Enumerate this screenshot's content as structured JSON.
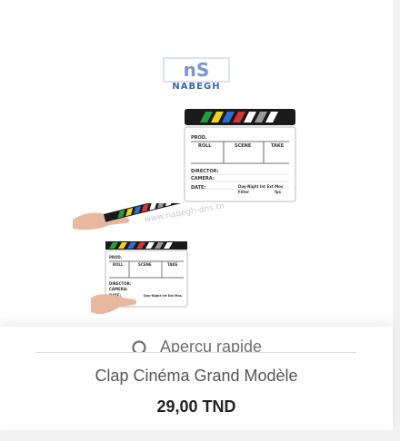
{
  "brand": {
    "logo_text": "NABEGH",
    "logo_mark": "nS",
    "watermark": "www.nabegh-dns.tn"
  },
  "clapper": {
    "prod_label": "PROD.",
    "roll_label": "ROLL",
    "scene_label": "SCENE",
    "take_label": "TAKE",
    "director_label": "DIRECTOR:",
    "camera_label": "CAMERA:",
    "date_label": "DATE:",
    "daynight_label": "Day-Night Int Ext Mos",
    "filter_label": "Filter",
    "fps_label": "fps",
    "stripe_colors": [
      "#1f9e3b",
      "#f0d020",
      "#2d6fd1",
      "#d83434",
      "#ffffff",
      "#9a9a9a",
      "#ffffff",
      "#1a1a1a"
    ]
  },
  "quick_view": {
    "label": "Aperçu rapide",
    "icon": "search-icon"
  },
  "product": {
    "name": "Clap Cinéma Grand Modèle",
    "price": "29,00 TND"
  }
}
